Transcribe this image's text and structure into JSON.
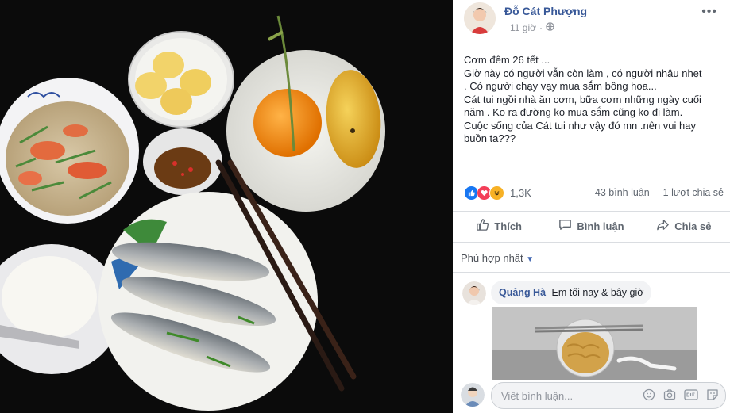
{
  "post": {
    "author": "Đỗ Cát Phượng",
    "time": "11 giờ",
    "separator": "·",
    "text_lines": [
      "Cơm đêm 26 tết ...",
      "Giờ này có người vẫn còn làm , có người nhậu nhẹt",
      ". Có người chạy vạy mua sắm bông hoa...",
      "Cát tui ngồi nhà ăn cơm, bữa cơm những ngày cuối",
      "năm . Ko ra đường ko mua sắm cũng ko đi làm.",
      "Cuộc sống của Cát tui như vậy đó mn .nên vui hay",
      "buồn ta???"
    ],
    "reaction_count": "1,3K",
    "comment_count": "43 bình luận",
    "share_count": "1 lượt chia sẻ",
    "reaction_icons": [
      "like-icon",
      "love-icon",
      "haha-icon"
    ]
  },
  "actions": {
    "like": "Thích",
    "comment": "Bình luận",
    "share": "Chia sẻ"
  },
  "sort_label": "Phù hợp nhất",
  "comments": [
    {
      "author": "Quảng Hà",
      "text": "Em tối nay & bây giờ"
    }
  ],
  "composer": {
    "placeholder": "Viết bình luận..."
  },
  "colors": {
    "link_blue": "#385898",
    "like_blue": "#1877f2",
    "love_red": "#f33e58",
    "haha_yellow": "#f7b125"
  }
}
